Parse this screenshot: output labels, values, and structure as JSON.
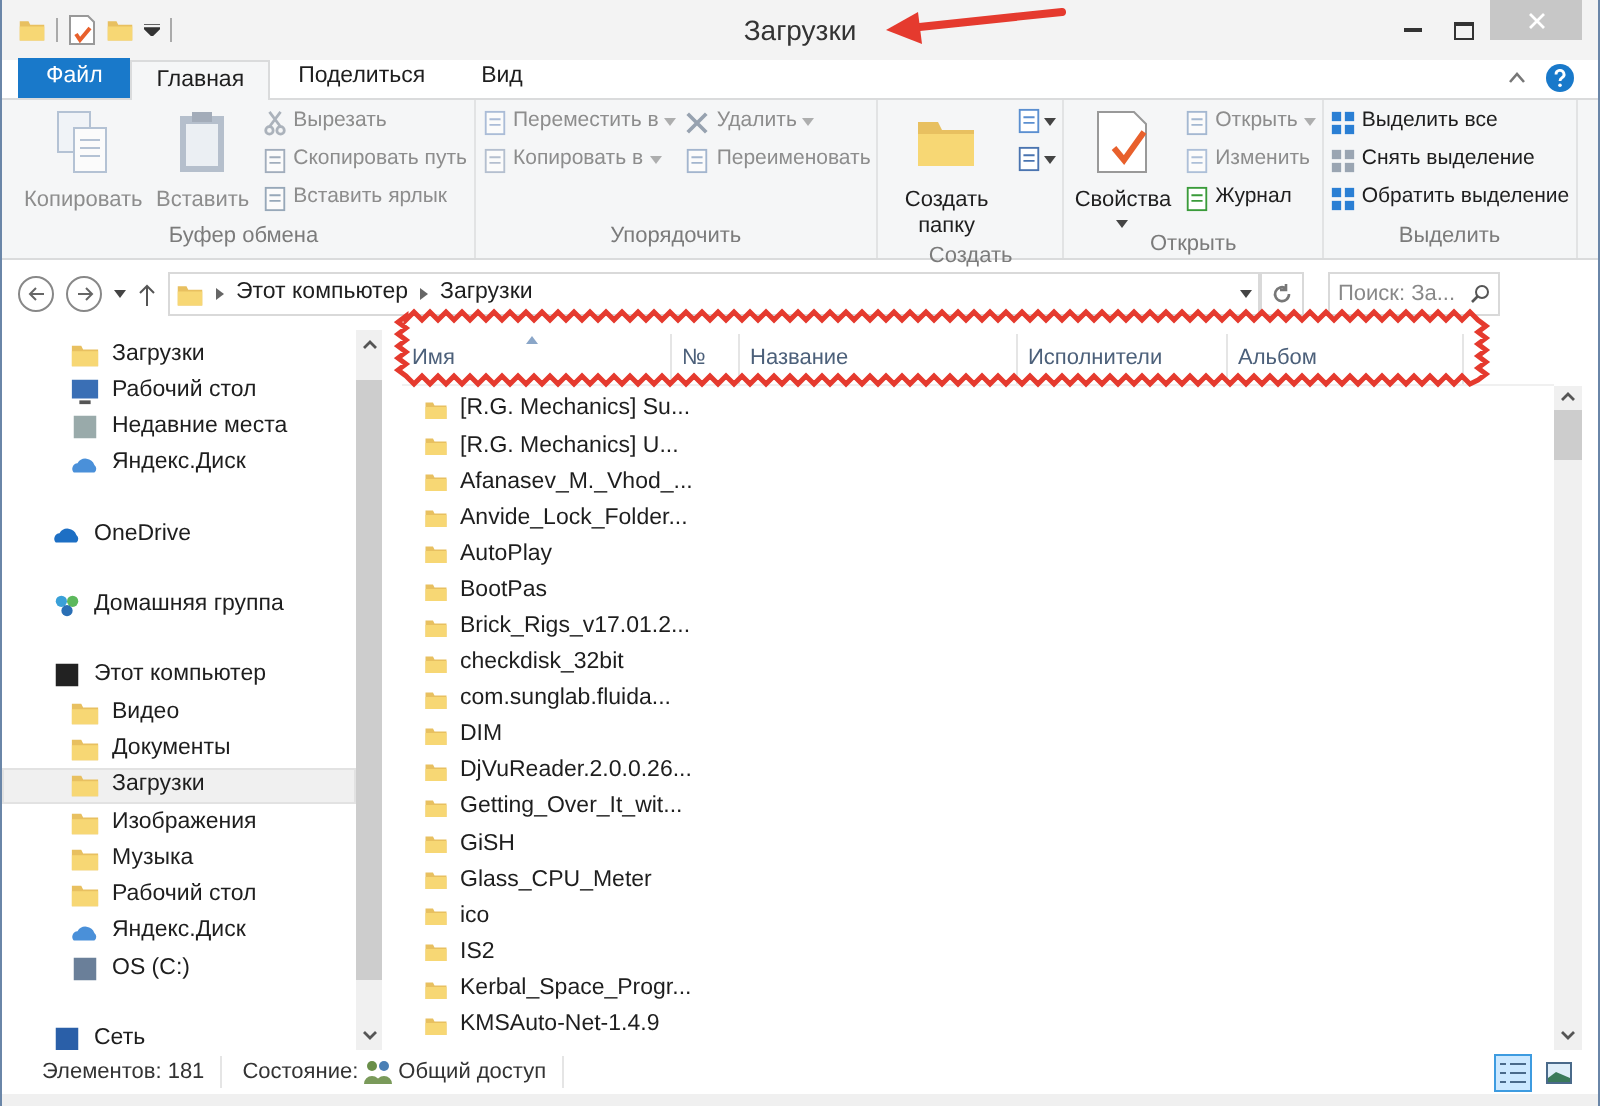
{
  "window": {
    "title": "Загрузки"
  },
  "tabs": [
    {
      "label": "Файл",
      "kind": "file",
      "selected": false
    },
    {
      "label": "Главная",
      "kind": "tab",
      "selected": true
    },
    {
      "label": "Поделиться",
      "kind": "tab",
      "selected": false
    },
    {
      "label": "Вид",
      "kind": "tab",
      "selected": false
    }
  ],
  "ribbon": {
    "groups": [
      {
        "label": "Буфер обмена",
        "items": [
          {
            "label": "Копировать",
            "kind": "large",
            "disabled": true
          },
          {
            "label": "Вставить",
            "kind": "large",
            "disabled": true
          },
          {
            "kind": "stack",
            "items": [
              {
                "label": "Вырезать",
                "disabled": true
              },
              {
                "label": "Скопировать путь",
                "disabled": true
              },
              {
                "label": "Вставить ярлык",
                "disabled": true
              }
            ]
          }
        ]
      },
      {
        "label": "Упорядочить",
        "items": [
          {
            "kind": "stack",
            "items": [
              {
                "label": "Переместить в",
                "disabled": true,
                "dropdown": true
              },
              {
                "label": "Копировать в",
                "disabled": true,
                "dropdown": true
              }
            ]
          },
          {
            "kind": "stack",
            "items": [
              {
                "label": "Удалить",
                "disabled": true,
                "dropdown": true
              },
              {
                "label": "Переименовать",
                "disabled": true
              }
            ]
          }
        ]
      },
      {
        "label": "Создать",
        "items": [
          {
            "label": "Создать папку",
            "kind": "large",
            "disabled": false
          },
          {
            "kind": "icons",
            "items": [
              {
                "disabled": false
              },
              {
                "disabled": false
              }
            ]
          }
        ]
      },
      {
        "label": "Открыть",
        "items": [
          {
            "label": "Свойства",
            "kind": "large",
            "disabled": false,
            "dropdown": true
          },
          {
            "kind": "stack",
            "items": [
              {
                "label": "Открыть",
                "disabled": true,
                "dropdown": true
              },
              {
                "label": "Изменить",
                "disabled": true
              },
              {
                "label": "Журнал",
                "disabled": false
              }
            ]
          }
        ]
      },
      {
        "label": "Выделить",
        "items": [
          {
            "kind": "stack",
            "items": [
              {
                "label": "Выделить все",
                "disabled": false
              },
              {
                "label": "Снять выделение",
                "disabled": false
              },
              {
                "label": "Обратить выделение",
                "disabled": false
              }
            ]
          }
        ]
      }
    ]
  },
  "address_bar": {
    "path": [
      "Этот компьютер",
      "Загрузки"
    ],
    "search_placeholder": "Поиск: За..."
  },
  "sidebar": {
    "sections": [
      {
        "items": [
          {
            "label": "Загрузки",
            "selected": false
          },
          {
            "label": "Рабочий стол",
            "selected": false
          },
          {
            "label": "Недавние места",
            "selected": false
          },
          {
            "label": "Яндекс.Диск",
            "selected": false
          }
        ]
      },
      {
        "items": [
          {
            "label": "OneDrive",
            "selected": false
          }
        ]
      },
      {
        "items": [
          {
            "label": "Домашняя группа",
            "selected": false
          }
        ]
      },
      {
        "items": [
          {
            "label": "Этот компьютер",
            "selected": false,
            "children": [
              {
                "label": "Видео",
                "selected": false
              },
              {
                "label": "Документы",
                "selected": false
              },
              {
                "label": "Загрузки",
                "selected": true
              },
              {
                "label": "Изображения",
                "selected": false
              },
              {
                "label": "Музыка",
                "selected": false
              },
              {
                "label": "Рабочий стол",
                "selected": false
              },
              {
                "label": "Яндекс.Диск",
                "selected": false
              },
              {
                "label": "OS (C:)",
                "selected": false
              }
            ]
          }
        ]
      },
      {
        "items": [
          {
            "label": "Сеть",
            "selected": false
          }
        ]
      }
    ]
  },
  "table": {
    "columns": [
      "Имя",
      "№",
      "Название",
      "Исполнители",
      "Альбом"
    ],
    "rows": [
      "[R.G. Mechanics] Su...",
      "[R.G. Mechanics] U...",
      "Afanasev_M._Vhod_...",
      "Anvide_Lock_Folder...",
      "AutoPlay",
      "BootPas",
      "Brick_Rigs_v17.01.2...",
      "checkdisk_32bit",
      "com.sunglab.fluida...",
      "DIM",
      "DjVuReader.2.0.0.26...",
      "Getting_Over_It_wit...",
      "GiSH",
      "Glass_CPU_Meter",
      "ico",
      "IS2",
      "Kerbal_Space_Progr...",
      "KMSAuto-Net-1.4.9"
    ]
  },
  "status_bar": {
    "count": "Элементов: 181",
    "state_label": "Состояние:",
    "state": "Общий доступ",
    "views": [
      {
        "kind": "details",
        "selected": true
      },
      {
        "kind": "tiles",
        "selected": false
      }
    ]
  }
}
